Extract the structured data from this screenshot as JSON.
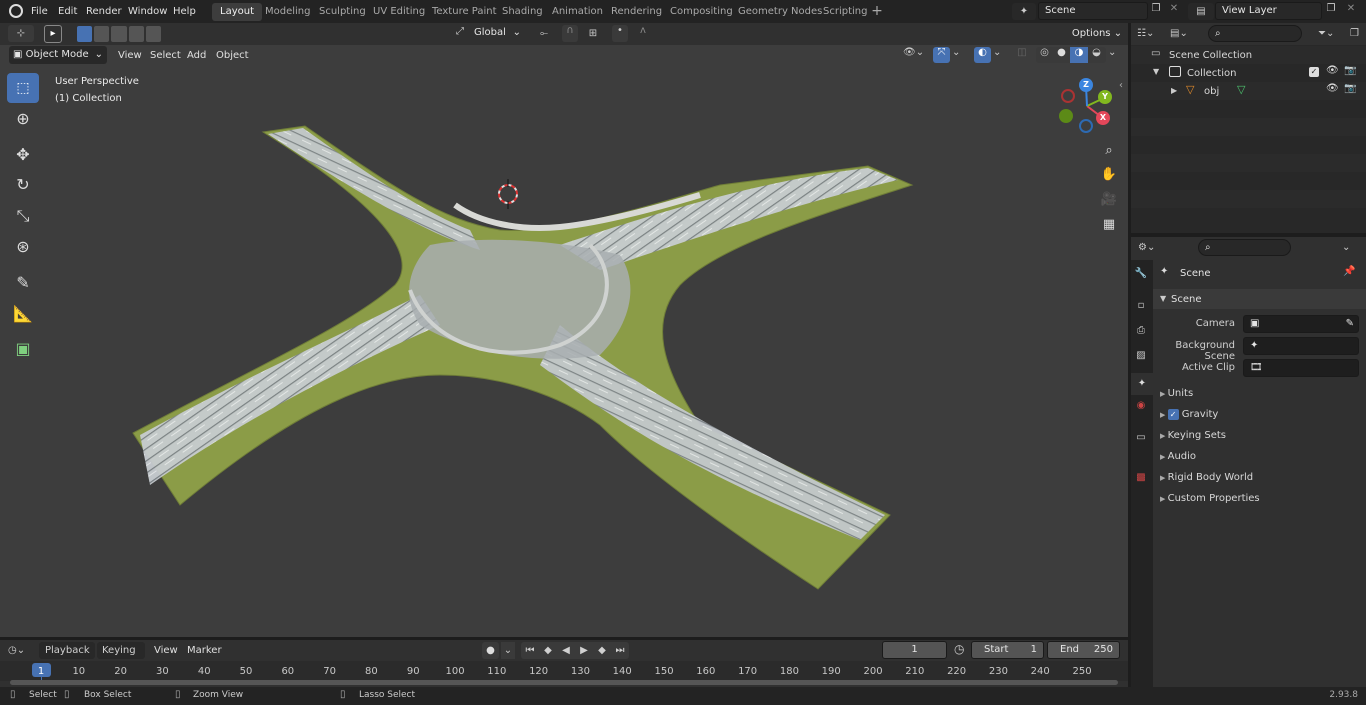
{
  "menus": [
    "File",
    "Edit",
    "Render",
    "Window",
    "Help"
  ],
  "workspaces": [
    "Layout",
    "Modeling",
    "Sculpting",
    "UV Editing",
    "Texture Paint",
    "Shading",
    "Animation",
    "Rendering",
    "Compositing",
    "Geometry Nodes",
    "Scripting"
  ],
  "scene_name": "Scene",
  "view_layer": "View Layer",
  "viewport": {
    "transform_orientation": "Global",
    "mode": "Object Mode",
    "header_menus": [
      "View",
      "Select",
      "Add",
      "Object"
    ],
    "options_label": "Options",
    "overlay_title": "User Perspective",
    "overlay_collection": "(1) Collection",
    "gizmo_axes": {
      "x": "X",
      "y": "Y",
      "z": "Z"
    }
  },
  "outliner": {
    "root": "Scene Collection",
    "collection": "Collection",
    "object": "obj"
  },
  "properties": {
    "header": "Scene",
    "panel": "Scene",
    "fields": [
      {
        "label": "Camera",
        "value": ""
      },
      {
        "label": "Background Scene",
        "value": ""
      },
      {
        "label": "Active Clip",
        "value": ""
      }
    ],
    "subpanels": [
      "Units",
      "Gravity",
      "Keying Sets",
      "Audio",
      "Rigid Body World",
      "Custom Properties"
    ],
    "gravity_checked": true
  },
  "timeline": {
    "menus": [
      "Playback",
      "Keying",
      "View",
      "Marker"
    ],
    "current_frame": "1",
    "start_label": "Start",
    "start": "1",
    "end_label": "End",
    "end": "250",
    "ticks": [
      "1",
      "10",
      "20",
      "30",
      "40",
      "50",
      "60",
      "70",
      "80",
      "90",
      "100",
      "110",
      "120",
      "130",
      "140",
      "150",
      "160",
      "170",
      "180",
      "190",
      "200",
      "210",
      "220",
      "230",
      "240",
      "250"
    ]
  },
  "statusbar": {
    "items": [
      "Select",
      "Box Select",
      "Zoom View",
      "Lasso Select"
    ],
    "version": "2.93.8"
  },
  "colors": {
    "accent": "#4772b3",
    "axis_x": "#e3475a",
    "axis_y": "#82b81f",
    "axis_z": "#3b86e0",
    "terrain": "#8fa04a",
    "road": "#c9ced2"
  }
}
